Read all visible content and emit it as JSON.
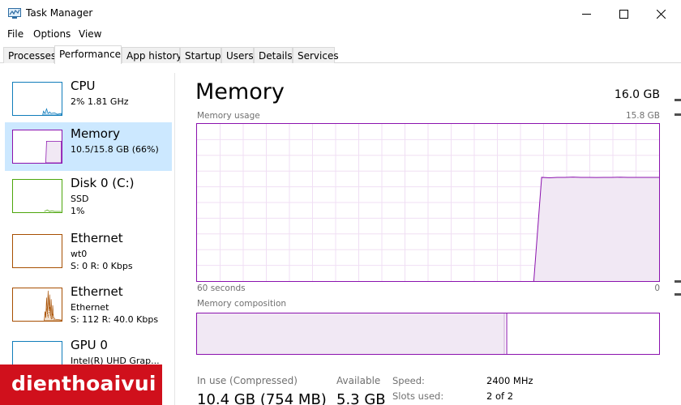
{
  "window": {
    "title": "Task Manager"
  },
  "menu": [
    "File",
    "Options",
    "View"
  ],
  "tabs": [
    "Processes",
    "Performance",
    "App history",
    "Startup",
    "Users",
    "Details",
    "Services"
  ],
  "active_tab": "Performance",
  "sidebar": [
    {
      "name": "CPU",
      "line2": "2%  1.81 GHz",
      "line3": "",
      "color": "#117dbb"
    },
    {
      "name": "Memory",
      "line2": "10.5/15.8 GB (66%)",
      "line3": "",
      "color": "#8b12ae"
    },
    {
      "name": "Disk 0 (C:)",
      "line2": "SSD",
      "line3": "1%",
      "color": "#4da60c"
    },
    {
      "name": "Ethernet",
      "line2": "wt0",
      "line3": "S: 0  R: 0 Kbps",
      "color": "#a74f01"
    },
    {
      "name": "Ethernet",
      "line2": "Ethernet",
      "line3": "S: 112  R: 40.0 Kbps",
      "color": "#a74f01"
    },
    {
      "name": "GPU 0",
      "line2": "Intel(R) UHD Grap...",
      "line3": "",
      "color": "#117dbb"
    }
  ],
  "main": {
    "title": "Memory",
    "total": "16.0 GB",
    "usage_label": "Memory usage",
    "usage_max": "15.8 GB",
    "time_left": "60 seconds",
    "time_right": "0",
    "composition_label": "Memory composition"
  },
  "stats": {
    "in_use_label": "In use (Compressed)",
    "in_use_value": "10.4 GB (754 MB)",
    "available_label": "Available",
    "available_value": "5.3 GB",
    "speed_label": "Speed:",
    "speed_value": "2400 MHz",
    "slots_label": "Slots used:",
    "slots_value": "2 of 2"
  },
  "graph": {
    "usage_fraction": 0.66,
    "series_fraction": [
      0,
      0,
      0,
      0,
      0,
      0,
      0,
      0,
      0,
      0,
      0,
      0,
      0,
      0,
      0,
      0,
      0,
      0,
      0,
      0,
      0,
      0,
      0,
      0,
      0,
      0,
      0,
      0,
      0,
      0,
      0,
      0,
      0,
      0,
      0,
      0,
      0,
      0,
      0,
      0,
      0,
      0,
      0,
      0,
      0.66,
      0.657,
      0.66,
      0.66,
      0.662,
      0.66,
      0.66,
      0.659,
      0.66,
      0.66,
      0.661,
      0.66,
      0.66,
      0.66,
      0.66,
      0.66
    ],
    "composition_in_use_fraction": 0.665,
    "line_color": "#8b12ae",
    "fill_color": "#f1e8f4"
  },
  "brand": {
    "text": "dienthoaivui"
  }
}
